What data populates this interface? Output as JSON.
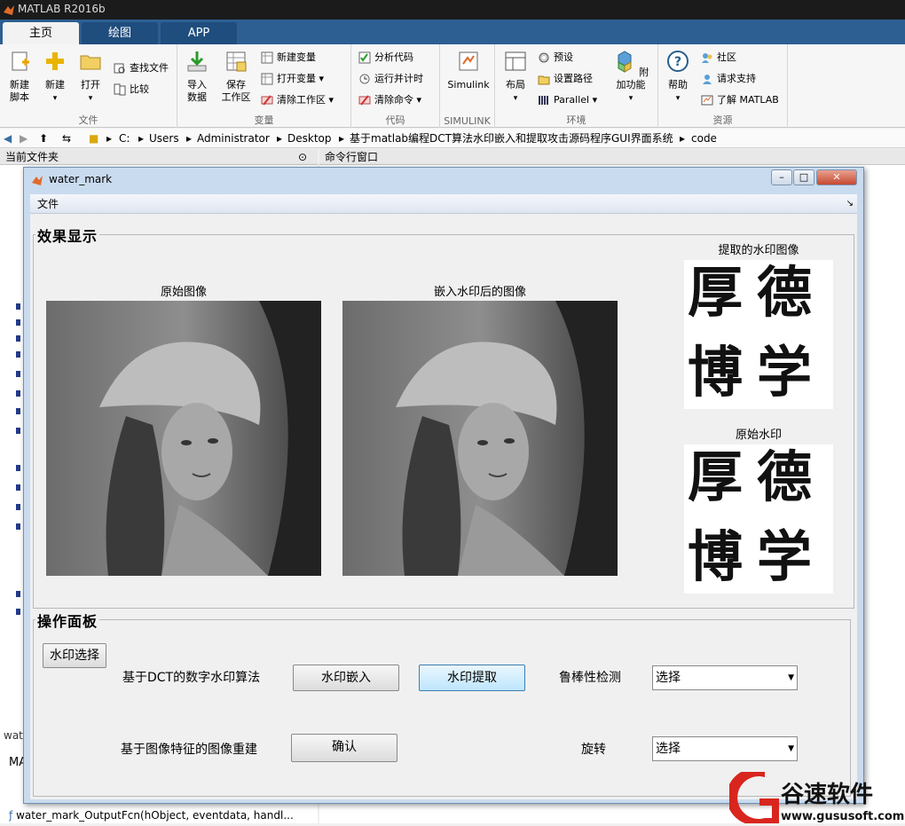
{
  "app": {
    "title": "MATLAB R2016b"
  },
  "tabs": [
    {
      "label": "主页"
    },
    {
      "label": "绘图"
    },
    {
      "label": "APP"
    }
  ],
  "ribbon": {
    "file_group": {
      "label": "文件",
      "new_script": "新建\n脚本",
      "new": "新建",
      "open": "打开",
      "find_files": "查找文件",
      "compare": "比较"
    },
    "variable_group": {
      "label": "变量",
      "import_data": "导入\n数据",
      "save_workspace": "保存\n工作区",
      "new_variable": "新建变量",
      "open_variable": "打开变量",
      "clear_workspace": "清除工作区"
    },
    "code_group": {
      "label": "代码",
      "analyze_code": "分析代码",
      "run_and_time": "运行并计时",
      "clear_commands": "清除命令"
    },
    "simulink_group": {
      "label": "SIMULINK",
      "simulink": "Simulink"
    },
    "env_group": {
      "label": "环境",
      "layout": "布局",
      "preferences": "预设",
      "set_path": "设置路径",
      "parallel": "Parallel",
      "addons": "附加功能"
    },
    "resources_group": {
      "label": "资源",
      "help": "帮助",
      "community": "社区",
      "request_support": "请求支持",
      "learn_matlab": "了解 MATLAB"
    }
  },
  "address": {
    "segments": [
      "C:",
      "Users",
      "Administrator",
      "Desktop",
      "基于matlab编程DCT算法水印嵌入和提取攻击源码程序GUI界面系统",
      "code"
    ]
  },
  "panes": {
    "current_folder": "当前文件夹",
    "command_window": "命令行窗口"
  },
  "left_pane": {
    "bottom_text": "wat",
    "mat_label": "MA",
    "file_row": "water_mark_OutputFcn(hObject, eventdata, handl..."
  },
  "window": {
    "title": "water_mark",
    "menu": "文件"
  },
  "effect_panel": {
    "title": "效果显示",
    "original_image": "原始图像",
    "embedded_image": "嵌入水印后的图像",
    "extracted_watermark": "提取的水印图像",
    "original_watermark": "原始水印",
    "wm_chars": [
      "厚",
      "德",
      "博",
      "学"
    ]
  },
  "operation_panel": {
    "title": "操作面板",
    "select_watermark": "水印选择",
    "dct_label": "基于DCT的数字水印算法",
    "embed": "水印嵌入",
    "extract": "水印提取",
    "robustness": "鲁棒性检测",
    "select_value": "选择",
    "reconstruct_label": "基于图像特征的图像重建",
    "confirm": "确认",
    "rotate": "旋转",
    "rotate_value": "选择"
  },
  "brand": {
    "name": "谷速软件",
    "url": "www.gususoft.com"
  }
}
